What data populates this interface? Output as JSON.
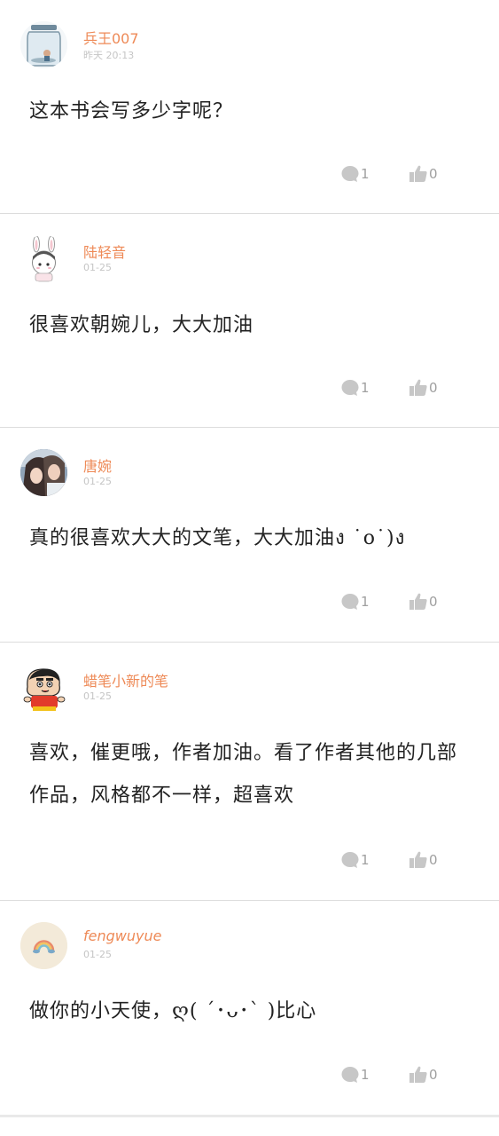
{
  "comments": [
    {
      "username": "兵王007",
      "time": "昨天  20:13",
      "text": "这本书会写多少字呢？",
      "replies": "1",
      "likes": "0",
      "avatar_icon": "glass-jar-avatar"
    },
    {
      "username": "陆轻音",
      "time": "01-25",
      "text": "很喜欢朝婉儿，大大加油",
      "replies": "1",
      "likes": "0",
      "avatar_icon": "bunny-girl-avatar"
    },
    {
      "username": "唐婉",
      "time": "01-25",
      "text": "真的很喜欢大大的文笔，大大加油ง ˙o˙)ง",
      "replies": "1",
      "likes": "0",
      "avatar_icon": "couple-illustration-avatar"
    },
    {
      "username": "蜡笔小新的笔",
      "time": "01-25",
      "text": "喜欢，催更哦，作者加油。看了作者其他的几部作品，风格都不一样，超喜欢",
      "replies": "1",
      "likes": "0",
      "avatar_icon": "crayon-shin-chan-avatar"
    },
    {
      "username": "fengwuyue",
      "time": "01-25",
      "text": "做你的小天使，ღ( ´･ᴗ･` )比心",
      "replies": "1",
      "likes": "0",
      "avatar_icon": "rainbow-avatar"
    }
  ],
  "colors": {
    "username": "#ee8a57",
    "time": "#c5c5c5",
    "action": "#a0a0a0",
    "divider": "#dcdcdc"
  }
}
